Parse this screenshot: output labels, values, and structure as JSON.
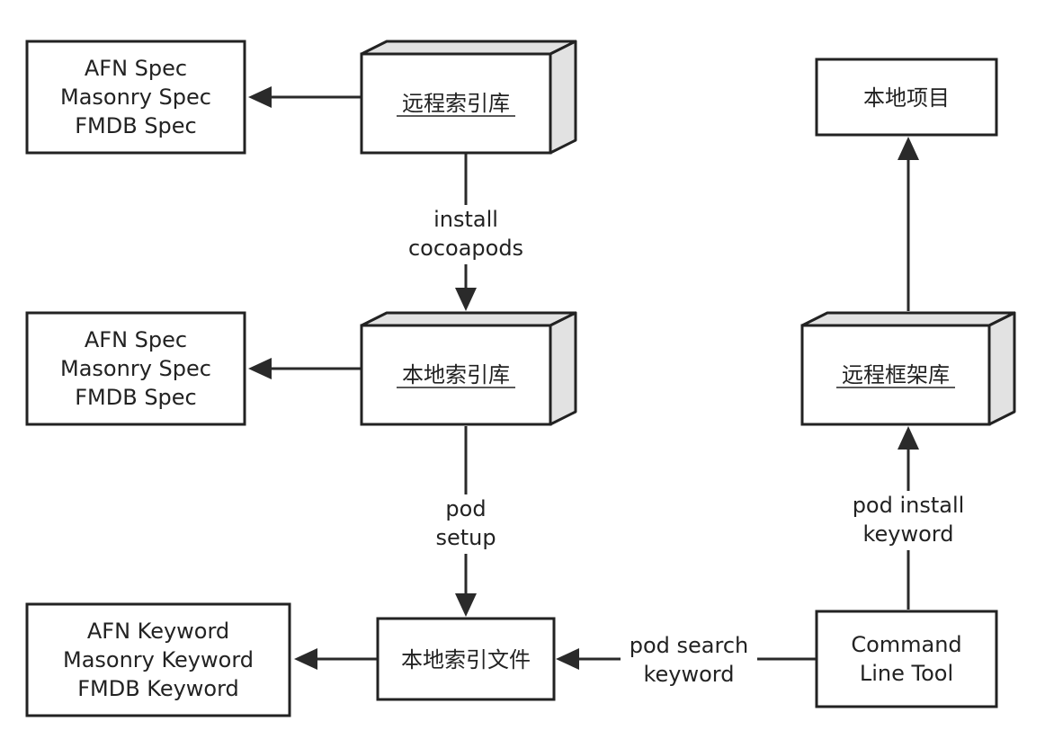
{
  "nodes": {
    "remote_index": {
      "label": "远程索引库"
    },
    "local_index": {
      "label": "本地索引库"
    },
    "remote_frameworks": {
      "label": "远程框架库"
    },
    "local_project": {
      "label": "本地项目"
    },
    "local_index_file": {
      "label": "本地索引文件"
    },
    "command_line_tool": {
      "lines": [
        "Command",
        "Line Tool"
      ]
    },
    "specs_top": {
      "lines": [
        "AFN Spec",
        "Masonry Spec",
        "FMDB Spec"
      ]
    },
    "specs_middle": {
      "lines": [
        "AFN Spec",
        "Masonry Spec",
        "FMDB Spec"
      ]
    },
    "keywords": {
      "lines": [
        "AFN Keyword",
        "Masonry Keyword",
        "FMDB Keyword"
      ]
    }
  },
  "edges": {
    "install_cocoapods": {
      "lines": [
        "install",
        "cocoapods"
      ]
    },
    "pod_setup": {
      "lines": [
        "pod",
        "setup"
      ]
    },
    "pod_install_keyword": {
      "lines": [
        "pod install",
        "keyword"
      ]
    },
    "pod_search_keyword": {
      "lines": [
        "pod search",
        "keyword"
      ]
    }
  },
  "colors": {
    "stroke": "#222222",
    "cube_side": "#e2e2e2",
    "background": "#ffffff"
  }
}
